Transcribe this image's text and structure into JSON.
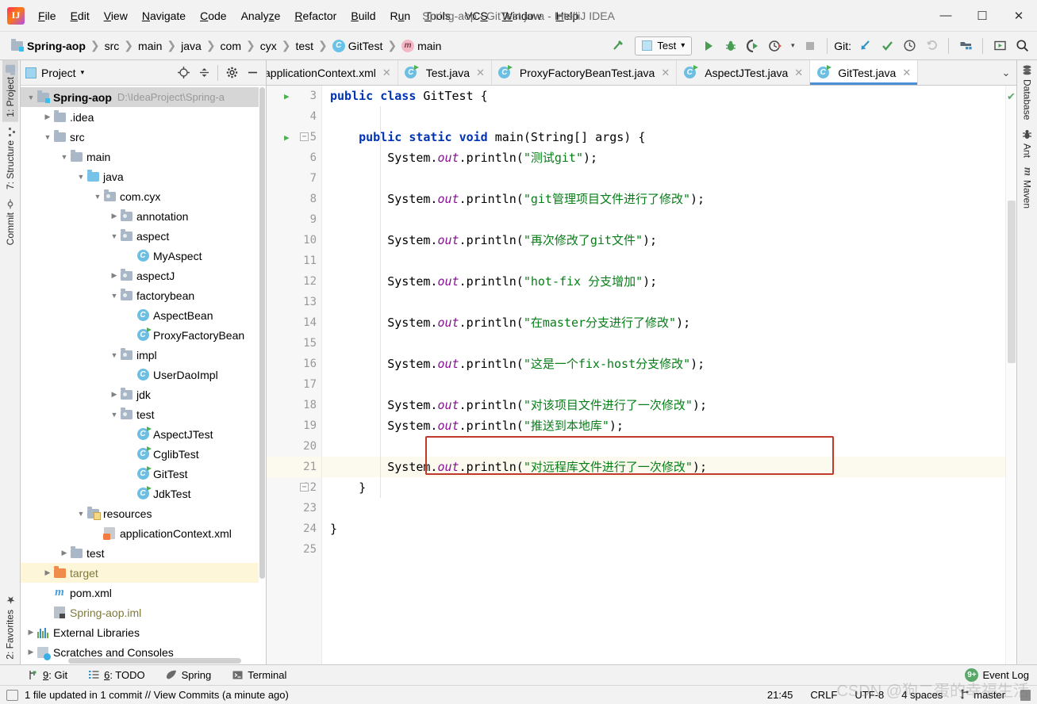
{
  "window": {
    "title": "Spring-aop - GitTest.java - IntelliJ IDEA",
    "logo": "intellij-idea-logo",
    "minimize": "—",
    "maximize": "☐",
    "close": "✕"
  },
  "menubar": {
    "items": [
      {
        "label": "File"
      },
      {
        "label": "Edit"
      },
      {
        "label": "View"
      },
      {
        "label": "Navigate"
      },
      {
        "label": "Code"
      },
      {
        "label": "Analyze"
      },
      {
        "label": "Refactor"
      },
      {
        "label": "Build"
      },
      {
        "label": "Run"
      },
      {
        "label": "Tools"
      },
      {
        "label": "VCS"
      },
      {
        "label": "Window"
      },
      {
        "label": "Help"
      }
    ]
  },
  "navbar": {
    "breadcrumbs": [
      {
        "label": "Spring-aop",
        "icon": "project-icon"
      },
      {
        "label": "src",
        "icon": "folder-icon"
      },
      {
        "label": "main",
        "icon": "folder-icon"
      },
      {
        "label": "java",
        "icon": "folder-icon"
      },
      {
        "label": "com",
        "icon": "folder-icon"
      },
      {
        "label": "cyx",
        "icon": "folder-icon"
      },
      {
        "label": "test",
        "icon": "folder-icon"
      },
      {
        "label": "GitTest",
        "icon": "class-icon"
      },
      {
        "label": "main",
        "icon": "method-icon"
      }
    ],
    "separator": "❯",
    "run_config": "Test",
    "dropdown_caret": "▾",
    "git_label": "Git:",
    "toolbar_icons": [
      "build-hammer-icon",
      "run-icon",
      "debug-icon",
      "run-coverage-icon",
      "profile-icon",
      "stop-icon",
      "update-project-icon",
      "commit-icon",
      "history-icon",
      "rollback-icon",
      "project-structure-icon",
      "select-opened-file-icon",
      "search-everywhere-icon"
    ]
  },
  "left_strip": {
    "tabs": [
      {
        "label": "1: Project",
        "icon": "project-panel-icon",
        "active": true
      },
      {
        "label": "7: Structure",
        "icon": "structure-icon",
        "active": false
      },
      {
        "label": "Commit",
        "icon": "commit-icon",
        "active": false
      }
    ],
    "bottom_tabs": [
      {
        "label": "2: Favorites",
        "icon": "star-icon"
      }
    ]
  },
  "right_strip": {
    "tabs": [
      {
        "label": "Database",
        "icon": "database-icon"
      },
      {
        "label": "Ant",
        "icon": "ant-icon"
      },
      {
        "label": "Maven",
        "icon": "maven-icon"
      }
    ]
  },
  "project_panel": {
    "title": "Project",
    "caret": "▾",
    "actions": [
      "locate-icon",
      "collapse-all-icon",
      "settings-gear-icon",
      "hide-icon"
    ],
    "tree": [
      {
        "label": "Spring-aop",
        "path": "D:\\IdeaProject\\Spring-a",
        "depth": 0,
        "arrow": "▼",
        "icon": "project-root-icon",
        "bold": true,
        "state": "sel"
      },
      {
        "label": ".idea",
        "depth": 1,
        "arrow": "▶",
        "icon": "folder-icon"
      },
      {
        "label": "src",
        "depth": 1,
        "arrow": "▼",
        "icon": "folder-icon"
      },
      {
        "label": "main",
        "depth": 2,
        "arrow": "▼",
        "icon": "folder-icon"
      },
      {
        "label": "java",
        "depth": 3,
        "arrow": "▼",
        "icon": "source-folder-icon"
      },
      {
        "label": "com.cyx",
        "depth": 4,
        "arrow": "▼",
        "icon": "package-icon"
      },
      {
        "label": "annotation",
        "depth": 5,
        "arrow": "▶",
        "icon": "package-icon"
      },
      {
        "label": "aspect",
        "depth": 5,
        "arrow": "▼",
        "icon": "package-icon"
      },
      {
        "label": "MyAspect",
        "depth": 6,
        "arrow": "",
        "icon": "class-icon"
      },
      {
        "label": "aspectJ",
        "depth": 5,
        "arrow": "▶",
        "icon": "package-icon"
      },
      {
        "label": "factorybean",
        "depth": 5,
        "arrow": "▼",
        "icon": "package-icon"
      },
      {
        "label": "AspectBean",
        "depth": 6,
        "arrow": "",
        "icon": "class-icon"
      },
      {
        "label": "ProxyFactoryBean",
        "depth": 6,
        "arrow": "",
        "icon": "runnable-class-icon"
      },
      {
        "label": "impl",
        "depth": 5,
        "arrow": "▼",
        "icon": "package-icon"
      },
      {
        "label": "UserDaoImpl",
        "depth": 6,
        "arrow": "",
        "icon": "class-icon"
      },
      {
        "label": "jdk",
        "depth": 5,
        "arrow": "▶",
        "icon": "package-icon"
      },
      {
        "label": "test",
        "depth": 5,
        "arrow": "▼",
        "icon": "package-icon"
      },
      {
        "label": "AspectJTest",
        "depth": 6,
        "arrow": "",
        "icon": "runnable-class-icon"
      },
      {
        "label": "CglibTest",
        "depth": 6,
        "arrow": "",
        "icon": "runnable-class-icon"
      },
      {
        "label": "GitTest",
        "depth": 6,
        "arrow": "",
        "icon": "runnable-class-icon"
      },
      {
        "label": "JdkTest",
        "depth": 6,
        "arrow": "",
        "icon": "runnable-class-icon"
      },
      {
        "label": "resources",
        "depth": 3,
        "arrow": "▼",
        "icon": "resources-folder-icon"
      },
      {
        "label": "applicationContext.xml",
        "depth": 4,
        "arrow": "",
        "icon": "spring-xml-icon"
      },
      {
        "label": "test",
        "depth": 2,
        "arrow": "▶",
        "icon": "folder-icon"
      },
      {
        "label": "target",
        "depth": 1,
        "arrow": "▶",
        "icon": "excluded-folder-icon",
        "state": "hl",
        "color": "olive"
      },
      {
        "label": "pom.xml",
        "depth": 1,
        "arrow": "",
        "icon": "maven-icon"
      },
      {
        "label": "Spring-aop.iml",
        "depth": 1,
        "arrow": "",
        "icon": "iml-icon",
        "color": "olive"
      },
      {
        "label": "External Libraries",
        "depth": 0,
        "arrow": "▶",
        "icon": "library-icon"
      },
      {
        "label": "Scratches and Consoles",
        "depth": 0,
        "arrow": "▶",
        "icon": "scratches-icon"
      }
    ]
  },
  "editor_tabs": [
    {
      "label": "applicationContext.xml",
      "icon": "spring-xml-icon",
      "active": false,
      "close": "✕"
    },
    {
      "label": "Test.java",
      "icon": "runnable-class-icon",
      "active": false,
      "close": "✕"
    },
    {
      "label": "ProxyFactoryBeanTest.java",
      "icon": "runnable-class-icon",
      "active": false,
      "close": "✕"
    },
    {
      "label": "AspectJTest.java",
      "icon": "runnable-class-icon",
      "active": false,
      "close": "✕"
    },
    {
      "label": "GitTest.java",
      "icon": "runnable-class-icon",
      "active": true,
      "close": "✕"
    }
  ],
  "editor_tabs_more": "⌄",
  "code": {
    "first_line_number": 3,
    "current_line": 21,
    "lines": [
      {
        "n": 3,
        "segments": [
          {
            "t": "public ",
            "c": "k"
          },
          {
            "t": "class ",
            "c": "k"
          },
          {
            "t": "GitTest {",
            "c": "pl"
          }
        ],
        "indent": 0,
        "runmark": true
      },
      {
        "n": 4,
        "segments": [],
        "indent": 0
      },
      {
        "n": 5,
        "segments": [
          {
            "t": "    public ",
            "c": "k"
          },
          {
            "t": "static ",
            "c": "k"
          },
          {
            "t": "void ",
            "c": "k"
          },
          {
            "t": "main(String[] args) {",
            "c": "pl"
          }
        ],
        "indent": 0,
        "runmark": true,
        "fold": true
      },
      {
        "n": 6,
        "segments": [
          {
            "t": "        System.",
            "c": "pl"
          },
          {
            "t": "out",
            "c": "f"
          },
          {
            "t": ".println(",
            "c": "pl"
          },
          {
            "t": "\"测试git\"",
            "c": "s"
          },
          {
            "t": ");",
            "c": "pl"
          }
        ]
      },
      {
        "n": 7,
        "segments": []
      },
      {
        "n": 8,
        "segments": [
          {
            "t": "        System.",
            "c": "pl"
          },
          {
            "t": "out",
            "c": "f"
          },
          {
            "t": ".println(",
            "c": "pl"
          },
          {
            "t": "\"git管理项目文件进行了修改\"",
            "c": "s"
          },
          {
            "t": ");",
            "c": "pl"
          }
        ]
      },
      {
        "n": 9,
        "segments": []
      },
      {
        "n": 10,
        "segments": [
          {
            "t": "        System.",
            "c": "pl"
          },
          {
            "t": "out",
            "c": "f"
          },
          {
            "t": ".println(",
            "c": "pl"
          },
          {
            "t": "\"再次修改了git文件\"",
            "c": "s"
          },
          {
            "t": ");",
            "c": "pl"
          }
        ]
      },
      {
        "n": 11,
        "segments": []
      },
      {
        "n": 12,
        "segments": [
          {
            "t": "        System.",
            "c": "pl"
          },
          {
            "t": "out",
            "c": "f"
          },
          {
            "t": ".println(",
            "c": "pl"
          },
          {
            "t": "\"hot-fix 分支增加\"",
            "c": "s"
          },
          {
            "t": ");",
            "c": "pl"
          }
        ]
      },
      {
        "n": 13,
        "segments": []
      },
      {
        "n": 14,
        "segments": [
          {
            "t": "        System.",
            "c": "pl"
          },
          {
            "t": "out",
            "c": "f"
          },
          {
            "t": ".println(",
            "c": "pl"
          },
          {
            "t": "\"在master分支进行了修改\"",
            "c": "s"
          },
          {
            "t": ");",
            "c": "pl"
          }
        ]
      },
      {
        "n": 15,
        "segments": []
      },
      {
        "n": 16,
        "segments": [
          {
            "t": "        System.",
            "c": "pl"
          },
          {
            "t": "out",
            "c": "f"
          },
          {
            "t": ".println(",
            "c": "pl"
          },
          {
            "t": "\"这是一个fix-host分支修改\"",
            "c": "s"
          },
          {
            "t": ");",
            "c": "pl"
          }
        ]
      },
      {
        "n": 17,
        "segments": []
      },
      {
        "n": 18,
        "segments": [
          {
            "t": "        System.",
            "c": "pl"
          },
          {
            "t": "out",
            "c": "f"
          },
          {
            "t": ".println(",
            "c": "pl"
          },
          {
            "t": "\"对该项目文件进行了一次修改\"",
            "c": "s"
          },
          {
            "t": ");",
            "c": "pl"
          }
        ]
      },
      {
        "n": 19,
        "segments": [
          {
            "t": "        System.",
            "c": "pl"
          },
          {
            "t": "out",
            "c": "f"
          },
          {
            "t": ".println(",
            "c": "pl"
          },
          {
            "t": "\"推送到本地库\"",
            "c": "s"
          },
          {
            "t": ");",
            "c": "pl"
          }
        ]
      },
      {
        "n": 20,
        "segments": []
      },
      {
        "n": 21,
        "segments": [
          {
            "t": "        System.",
            "c": "pl"
          },
          {
            "t": "out",
            "c": "f"
          },
          {
            "t": ".println(",
            "c": "pl"
          },
          {
            "t": "\"对远程库文件进行了一次修改\"",
            "c": "s"
          },
          {
            "t": ");",
            "c": "pl"
          }
        ],
        "current": true
      },
      {
        "n": 22,
        "segments": [
          {
            "t": "    }",
            "c": "pl"
          }
        ],
        "fold": true
      },
      {
        "n": 23,
        "segments": []
      },
      {
        "n": 24,
        "segments": [
          {
            "t": "}",
            "c": "pl"
          }
        ]
      },
      {
        "n": 25,
        "segments": []
      }
    ],
    "annotation_box": {
      "line": 21,
      "color": "#c0392b"
    },
    "inspection_status": "✔"
  },
  "bottom_bar": {
    "tools": [
      {
        "label": "9: Git",
        "icon": "git-branch-icon"
      },
      {
        "label": "6: TODO",
        "icon": "todo-list-icon"
      },
      {
        "label": "Spring",
        "icon": "spring-leaf-icon"
      },
      {
        "label": "Terminal",
        "icon": "terminal-icon"
      }
    ],
    "event_log": {
      "label": "Event Log",
      "badge": "9+"
    }
  },
  "status_bar": {
    "message": "1 file updated in 1 commit // View Commits (a minute ago)",
    "message_icon": "notification-icon",
    "time": "21:45",
    "line_separator": "CRLF",
    "encoding": "UTF-8",
    "indent": "4 spaces",
    "branch": "master",
    "branch_icon": "git-branch-icon",
    "lock_icon": "lock-icon"
  },
  "watermark": "CSDN @狗二蛋的幸福生活"
}
